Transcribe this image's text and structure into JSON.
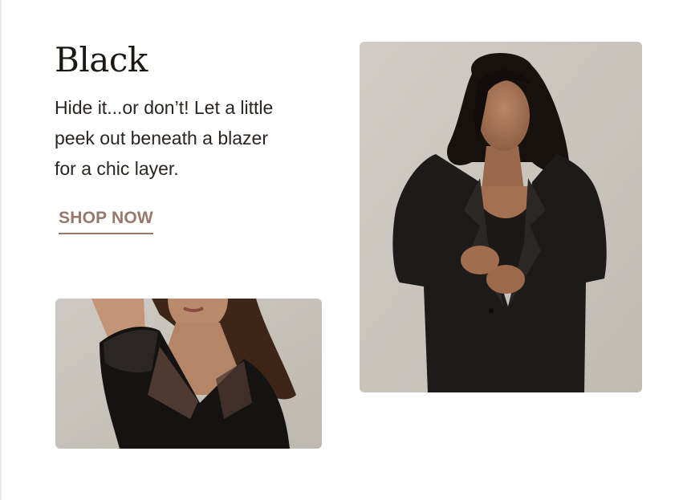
{
  "section": {
    "title": "Black",
    "description": "Hide it...or don’t! Let a little peek out beneath a blazer for a chic layer.",
    "cta_label": "SHOP NOW"
  },
  "images": {
    "main": {
      "alt": "Model wearing a black blazer over a sheer-panel black top"
    },
    "secondary": {
      "alt": "Model in a black top with sheer mesh sleeves"
    }
  },
  "colors": {
    "title_text": "#1b1714",
    "body_text": "#2a2522",
    "cta": "#96796b",
    "photo_background": "#c9c3bd"
  }
}
